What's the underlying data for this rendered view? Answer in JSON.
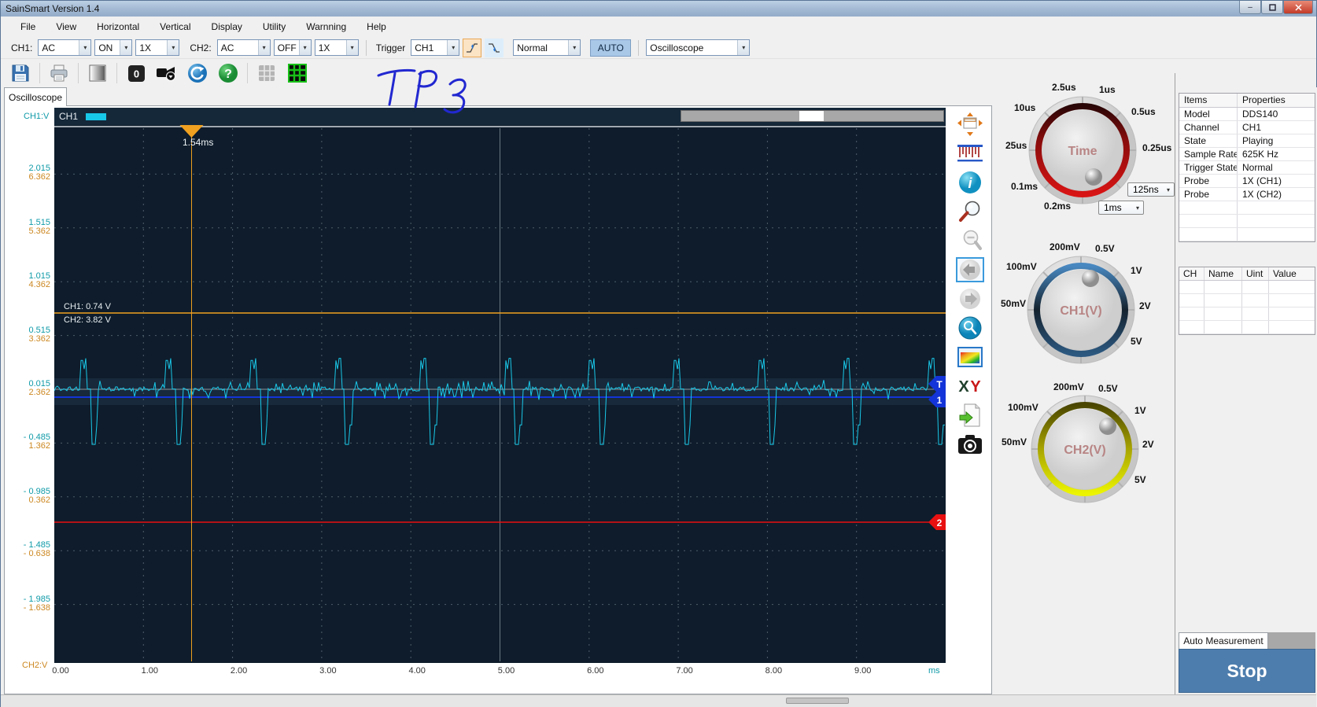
{
  "window": {
    "title": "SainSmart  Version 1.4"
  },
  "menu": {
    "items": [
      "File",
      "View",
      "Horizontal",
      "Vertical",
      "Display",
      "Utility",
      "Warnning",
      "Help"
    ]
  },
  "toolbar": {
    "ch1_label": "CH1:",
    "ch1_coupling": "AC",
    "ch1_display": "ON",
    "ch1_probe": "1X",
    "ch2_label": "CH2:",
    "ch2_coupling": "AC",
    "ch2_display": "OFF",
    "ch2_probe": "1X",
    "trigger_label": "Trigger",
    "trigger_source": "CH1",
    "trigger_mode": "Normal",
    "auto_button": "AUTO",
    "device_mode": "Oscilloscope"
  },
  "icons": {
    "zero_label": "0",
    "help_glyph": "?",
    "info_glyph": "i",
    "x_glyph": "X",
    "y_glyph": "Y"
  },
  "tab": {
    "label": "Oscilloscope"
  },
  "annotation": {
    "text": "TP 3",
    "color": "#2228d0"
  },
  "scope": {
    "channel_badge": "CH1",
    "cursor_time_label": "1.54ms",
    "ch1_level_label": "CH1: 0.74 V",
    "ch2_level_label": "CH2: 3.82 V",
    "y_axis_top_label": "CH1:V",
    "y_axis_bottom_label": "CH2:V",
    "x_unit_label": "ms",
    "y_labels_ch1": [
      "2.015",
      "1.515",
      "1.015",
      "0.515",
      "0.015",
      "- 0.485",
      "- 0.985",
      "- 1.485",
      "- 1.985"
    ],
    "y_labels_ch2": [
      "6.362",
      "5.362",
      "4.362",
      "3.362",
      "2.362",
      "1.362",
      "0.362",
      "- 0.638",
      "- 1.638"
    ],
    "x_labels": [
      "0.00",
      "1.00",
      "2.00",
      "3.00",
      "4.00",
      "5.00",
      "6.00",
      "7.00",
      "8.00",
      "9.00"
    ],
    "markers": {
      "trigger": "T",
      "ch1": "1",
      "ch2": "2"
    },
    "colors": {
      "bg": "#0e1c2b",
      "grid": "#4f5e6a",
      "center_line": "#8c969e",
      "wave": "#1ac8e8",
      "cursor": "#f0a120",
      "ch1_marker": "#1334d8",
      "ch2_marker": "#e81010"
    }
  },
  "chart_data": {
    "type": "line",
    "title": "CH1 pulse train",
    "x_unit": "ms",
    "y_unit": "V",
    "x_range": [
      0,
      10
    ],
    "y_ticks_ch1": [
      2.015,
      1.515,
      1.015,
      0.515,
      0.015,
      -0.485,
      -0.985,
      -1.485,
      -1.985
    ],
    "y_ticks_ch2": [
      6.362,
      5.362,
      4.362,
      3.362,
      2.362,
      1.362,
      0.362,
      -0.638,
      -1.638
    ],
    "baseline_v": 0.015,
    "noise_vpp": 0.1,
    "pulse_times_ms": [
      0.3,
      1.25,
      2.2,
      3.15,
      4.1,
      5.05,
      6.0,
      6.95,
      7.9,
      8.85,
      9.8
    ],
    "pulse_positive_v": 0.3,
    "pulse_negative_v": -0.5,
    "cursor_time_ms": 1.54,
    "ch1_cursor_v": 0.74,
    "ch2_cursor_v": 3.82,
    "ch1_position_line_v": -0.06,
    "ch2_position_line_v": -1.23
  },
  "knobs": {
    "time": {
      "center_label": "Time",
      "range_select": "125ns",
      "base_select": "1ms",
      "scale_labels": [
        "2.5us",
        "1us",
        "10us",
        "0.5us",
        "25us",
        "0.25us",
        "0.1ms",
        "0.2ms"
      ]
    },
    "ch1": {
      "center_label": "CH1(V)",
      "scale_labels": [
        "200mV",
        "0.5V",
        "100mV",
        "1V",
        "50mV",
        "2V",
        "5V"
      ]
    },
    "ch2": {
      "center_label": "CH2(V)",
      "scale_labels": [
        "200mV",
        "0.5V",
        "100mV",
        "1V",
        "50mV",
        "2V",
        "5V"
      ]
    }
  },
  "properties": {
    "headers": [
      "Items",
      "Properties"
    ],
    "rows": [
      [
        "Model",
        "DDS140"
      ],
      [
        "Channel",
        "CH1"
      ],
      [
        "State",
        "Playing"
      ],
      [
        "Sample Rate",
        "625K Hz"
      ],
      [
        "Trigger State",
        "Normal"
      ],
      [
        "Probe",
        "1X (CH1)"
      ],
      [
        "Probe",
        "1X (CH2)"
      ]
    ]
  },
  "measure_table": {
    "headers": [
      "CH",
      "Name",
      "Uint",
      "Value"
    ]
  },
  "bottom_panel": {
    "tab_label": "Auto Measurement",
    "stop_label": "Stop"
  }
}
